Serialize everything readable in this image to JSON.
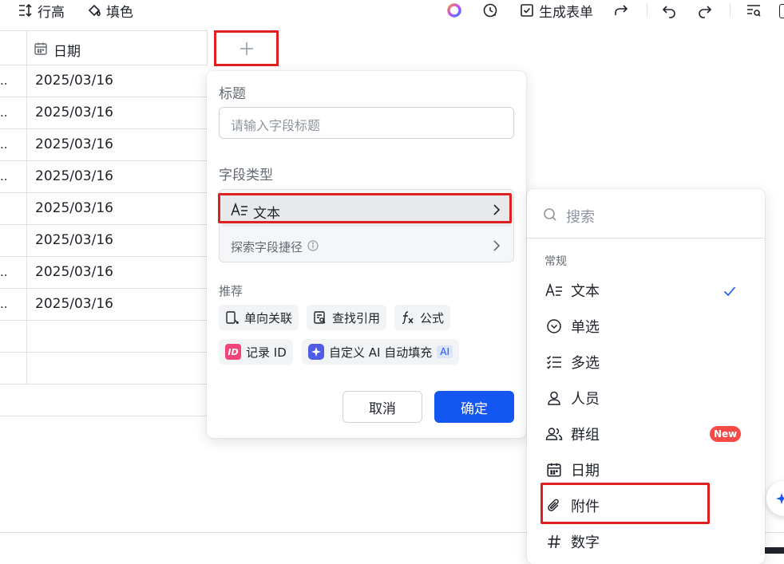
{
  "toolbar": {
    "row_height": "行高",
    "fill_color": "填色",
    "generate_form": "生成表单"
  },
  "grid": {
    "date_column": "日期",
    "rows": [
      {
        "prefix": "..",
        "date": "2025/03/16"
      },
      {
        "prefix": "..",
        "date": "2025/03/16"
      },
      {
        "prefix": "..",
        "date": "2025/03/16"
      },
      {
        "prefix": "..",
        "date": "2025/03/16"
      },
      {
        "prefix": "",
        "date": "2025/03/16"
      },
      {
        "prefix": "",
        "date": "2025/03/16"
      },
      {
        "prefix": "..",
        "date": "2025/03/16"
      },
      {
        "prefix": "..",
        "date": "2025/03/16"
      },
      {
        "prefix": "",
        "date": ""
      },
      {
        "prefix": "",
        "date": ""
      }
    ]
  },
  "panel": {
    "title_label": "标题",
    "title_placeholder": "请输入字段标题",
    "type_label": "字段类型",
    "selected_type": "文本",
    "explore_shortcut": "探索字段捷径",
    "recommend_label": "推荐",
    "recommend": [
      "单向关联",
      "查找引用",
      "公式",
      "记录 ID",
      "自定义 AI 自动填充"
    ],
    "ai_badge": "AI",
    "cancel": "取消",
    "confirm": "确定"
  },
  "menu": {
    "search_placeholder": "搜索",
    "section": "常规",
    "items": [
      "文本",
      "单选",
      "多选",
      "人员",
      "群组",
      "日期",
      "附件",
      "数字"
    ],
    "new_badge": "New"
  },
  "colors": {
    "primary": "#1456f0",
    "highlight": "#e02020",
    "new_badge": "#f54a45"
  }
}
